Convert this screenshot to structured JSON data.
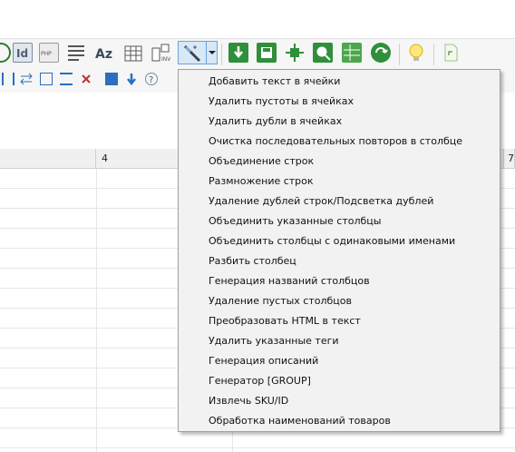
{
  "toolbar": {
    "magic_button_label": "",
    "icons": [
      "lightbulb-icon",
      "id-icon",
      "php-icon",
      "text-lines-icon",
      "az-sort-icon",
      "table-icon",
      "columns-icon",
      "wand-icon"
    ]
  },
  "grid": {
    "column_headers": [
      "",
      "4",
      "",
      "7"
    ]
  },
  "menu": {
    "items": [
      "Добавить текст в ячейки",
      "Удалить пустоты в ячейках",
      "Удалить дубли в ячейках",
      "Очистка последовательных повторов в столбце",
      "Объединение строк",
      "Размножение строк",
      "Удаление дублей строк/Подсветка дублей",
      "Объединить указанные столбцы",
      "Объединить столбцы с одинаковыми именами",
      "Разбить столбец",
      "Генерация названий столбцов",
      "Удаление пустых столбцов",
      "Преобразовать HTML в текст",
      "Удалить указанные теги",
      "Генерация описаний",
      "Генератор [GROUP]",
      "Извлечь SKU/ID",
      "Обработка наименований товаров"
    ]
  },
  "colors": {
    "accent": "#6fa3d8",
    "menu_bg": "#f2f2f2",
    "toolbar_bg": "#f6f6f6"
  }
}
